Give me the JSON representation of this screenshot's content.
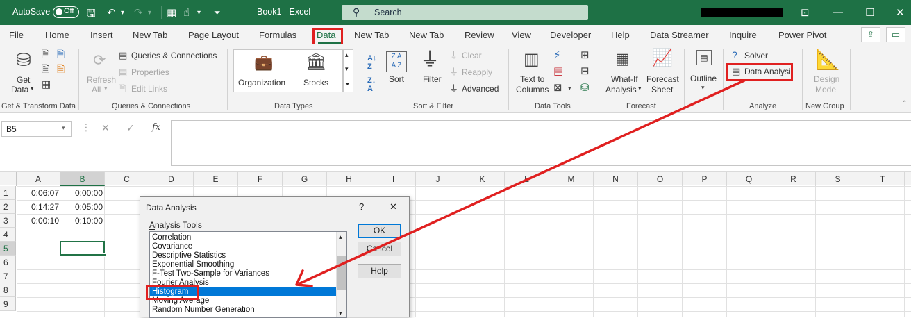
{
  "titlebar": {
    "autosave_label": "AutoSave",
    "autosave_state": "Off",
    "search_placeholder": "Search",
    "doc_title": "Book1  -  Excel"
  },
  "tabs": [
    "File",
    "Home",
    "Insert",
    "New Tab",
    "Page Layout",
    "Formulas",
    "Data",
    "New Tab",
    "New Tab",
    "Review",
    "View",
    "Developer",
    "Help",
    "Data Streamer",
    "Inquire",
    "Power Pivot"
  ],
  "ribbon": {
    "get_transform": {
      "get_data_line1": "Get",
      "get_data_line2": "Data",
      "group": "Get & Transform Data"
    },
    "queries": {
      "refresh_line1": "Refresh",
      "refresh_line2": "All",
      "queries_connections": "Queries & Connections",
      "properties": "Properties",
      "edit_links": "Edit Links",
      "group": "Queries & Connections"
    },
    "data_types": {
      "organization": "Organization",
      "stocks": "Stocks",
      "group": "Data Types"
    },
    "sort_filter": {
      "sort": "Sort",
      "filter": "Filter",
      "clear": "Clear",
      "reapply": "Reapply",
      "advanced": "Advanced",
      "az": "A Z",
      "za": "Z A",
      "group": "Sort & Filter"
    },
    "data_tools": {
      "text_to_line1": "Text to",
      "text_to_line2": "Columns",
      "group": "Data Tools"
    },
    "forecast": {
      "whatif_line1": "What-If",
      "whatif_line2": "Analysis",
      "sheet_line1": "Forecast",
      "sheet_line2": "Sheet",
      "group": "Forecast"
    },
    "outline": {
      "label": "Outline"
    },
    "analyze": {
      "solver": "Solver",
      "data_analysis": "Data Analysi",
      "group": "Analyze"
    },
    "new_group": {
      "design_line1": "Design",
      "design_line2": "Mode",
      "group": "New Group"
    }
  },
  "formula_bar": {
    "name_box": "B5",
    "fx": "fx",
    "content": ""
  },
  "grid": {
    "columns": [
      "A",
      "B",
      "C",
      "D",
      "E",
      "F",
      "G",
      "H",
      "I",
      "J",
      "K",
      "L",
      "M",
      "N",
      "O",
      "P",
      "Q",
      "R",
      "S",
      "T"
    ],
    "rows": [
      "1",
      "2",
      "3",
      "4",
      "5",
      "6",
      "7",
      "8",
      "9"
    ],
    "cells": {
      "A1": "0:06:07",
      "B1": "0:00:00",
      "A2": "0:14:27",
      "B2": "0:05:00",
      "A3": "0:00:10",
      "B3": "0:10:00"
    }
  },
  "dialog": {
    "title": "Data Analysis",
    "help_glyph": "?",
    "close_glyph": "✕",
    "list_label": "Analysis Tools",
    "ok": "OK",
    "cancel": "Cancel",
    "help": "Help",
    "items": [
      "Correlation",
      "Covariance",
      "Descriptive Statistics",
      "Exponential Smoothing",
      "F-Test Two-Sample for Variances",
      "Fourier Analysis",
      "Histogram",
      "Moving Average",
      "Random Number Generation"
    ],
    "selected": "Histogram"
  },
  "colors": {
    "excel_green": "#1e7145",
    "highlight_red": "#e02020",
    "selection_blue": "#0078d7"
  }
}
